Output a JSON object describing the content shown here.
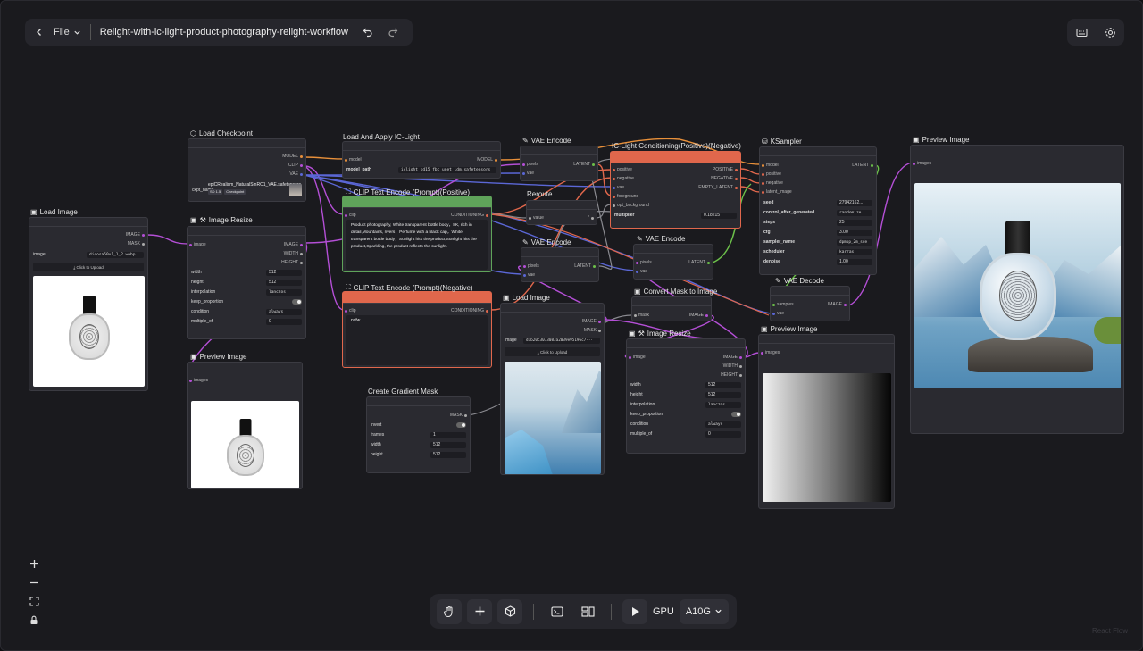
{
  "topbar": {
    "back_icon": "chevron-left-icon",
    "file_label": "File",
    "title": "Relight-with-ic-light-product-photography-relight-workflow",
    "undo_icon": "undo-icon",
    "redo_icon": "redo-icon"
  },
  "right_tools": {
    "icons": [
      "keyboard-icon",
      "gear-icon"
    ]
  },
  "nodes": {
    "load_checkpoint": {
      "title": "Load Checkpoint",
      "outputs": [
        "MODEL",
        "CLIP",
        "VAE"
      ],
      "ckpt_label": "ckpt_name",
      "ckpt_value": "epiCRealism_NaturalSinRC1_VAE.safetensors",
      "tags": [
        "SD 1.5",
        "Checkpoint"
      ]
    },
    "load_apply_ic_light": {
      "title": "Load And Apply IC-Light",
      "input": "model",
      "output": "MODEL",
      "model_path_label": "model_path",
      "model_path_value": "iclight_sd15_fbc_unet_ldm.safetensors"
    },
    "clip_pos": {
      "title": "CLIP Text Encode (Prompt)(Positive)",
      "input": "clip",
      "output": "CONDITIONING",
      "text": "Product photography, White transparent bottle body，8K, rich in detail,Mountains, rivers，Perfume with a black cap，White transparent bottle body，Sunlight hits the product,Sunlight hits the product,Sparkling, the product reflects the sunlight."
    },
    "clip_neg": {
      "title": "CLIP Text Encode (Prompt)(Negative)",
      "input": "clip",
      "output": "CONDITIONING",
      "text": "nsfw"
    },
    "load_image_1": {
      "title": "Load Image",
      "outputs": [
        "IMAGE",
        "MASK"
      ],
      "image_label": "image",
      "image_value": "dicosa50v1_1_2.webp",
      "upload_label": "Click to Upload"
    },
    "image_resize_1": {
      "title": "Image Resize",
      "input": "image",
      "outputs": [
        "IMAGE",
        "WIDTH",
        "HEIGHT"
      ],
      "widgets": [
        {
          "label": "width",
          "value": "512"
        },
        {
          "label": "height",
          "value": "512"
        },
        {
          "label": "interpolation",
          "value": "lanczos"
        },
        {
          "label": "keep_proportion",
          "value": ""
        },
        {
          "label": "condition",
          "value": "always"
        },
        {
          "label": "multiple_of",
          "value": "0"
        }
      ]
    },
    "preview_1": {
      "title": "Preview Image",
      "input": "images"
    },
    "vae_encode_1": {
      "title": "VAE Encode",
      "inputs": [
        "pixels",
        "vae"
      ],
      "output": "LATENT"
    },
    "reroute": {
      "title": "Reroute",
      "port": "value"
    },
    "vae_encode_2": {
      "title": "VAE Encode",
      "inputs": [
        "pixels",
        "vae"
      ],
      "output": "LATENT"
    },
    "load_image_2": {
      "title": "Load Image",
      "outputs": [
        "IMAGE",
        "MASK"
      ],
      "image_label": "image",
      "image_value": "d1b20c3073083a2039e95196c7···",
      "upload_label": "Click to Upload"
    },
    "gradient_mask": {
      "title": "Create Gradient Mask",
      "output": "MASK",
      "widgets": [
        {
          "label": "invert",
          "value": ""
        },
        {
          "label": "frames",
          "value": "1"
        },
        {
          "label": "width",
          "value": "512"
        },
        {
          "label": "height",
          "value": "512"
        }
      ]
    },
    "ic_cond": {
      "title": "IC-Light Conditioning(Positive)(Negative)",
      "inputs": [
        "positive",
        "negative",
        "vae",
        "foreground",
        "opt_background"
      ],
      "outputs": [
        "POSITIVE",
        "NEGATIVE",
        "EMPTY_LATENT"
      ],
      "multiplier_label": "multiplier",
      "multiplier_value": "0.18215"
    },
    "vae_encode_3": {
      "title": "VAE Encode",
      "inputs": [
        "pixels",
        "vae"
      ],
      "output": "LATENT"
    },
    "convert_mask": {
      "title": "Convert Mask to Image",
      "input": "mask",
      "output": "IMAGE"
    },
    "image_resize_2": {
      "title": "Image Resize",
      "input": "image",
      "outputs": [
        "IMAGE",
        "WIDTH",
        "HEIGHT"
      ],
      "widgets": [
        {
          "label": "width",
          "value": "512"
        },
        {
          "label": "height",
          "value": "512"
        },
        {
          "label": "interpolation",
          "value": "lanczos"
        },
        {
          "label": "keep_proportion",
          "value": ""
        },
        {
          "label": "condition",
          "value": "always"
        },
        {
          "label": "multiple_of",
          "value": "0"
        }
      ]
    },
    "ksampler": {
      "title": "KSampler",
      "inputs": [
        "model",
        "positive",
        "negative",
        "latent_image"
      ],
      "output": "LATENT",
      "widgets": [
        {
          "label": "seed",
          "value": "27942162..."
        },
        {
          "label": "control_after_generated",
          "value": "randomize"
        },
        {
          "label": "steps",
          "value": "25"
        },
        {
          "label": "cfg",
          "value": "3.00"
        },
        {
          "label": "sampler_name",
          "value": "dpmpp_2m_sde"
        },
        {
          "label": "scheduler",
          "value": "karras"
        },
        {
          "label": "denoise",
          "value": "1.00"
        }
      ]
    },
    "vae_decode": {
      "title": "VAE Decode",
      "inputs": [
        "samples",
        "vae"
      ],
      "output": "IMAGE"
    },
    "preview_2": {
      "title": "Preview Image",
      "input": "images"
    },
    "preview_3": {
      "title": "Preview Image",
      "input": "images"
    }
  },
  "bottombar": {
    "tools": [
      "hand-icon",
      "plus-icon",
      "cube-icon",
      "terminal-icon",
      "layout-icon",
      "play-icon"
    ],
    "gpu_label": "GPU",
    "gpu_value": "A10G"
  },
  "zoom_controls": [
    "zoom-in-icon",
    "zoom-out-icon",
    "fit-view-icon",
    "lock-icon"
  ],
  "attribution": "React Flow",
  "colors": {
    "canvas": "#1a1a1e",
    "node": "#2a2a30",
    "positive_header": "#5fa35a",
    "negative_header": "#e0674c",
    "wire_purple": "#b44fd6",
    "wire_orange": "#e8903a",
    "wire_blue": "#5b67d6",
    "wire_red": "#e0674c",
    "wire_green": "#6cc04a",
    "wire_gray": "#8a8a90"
  }
}
